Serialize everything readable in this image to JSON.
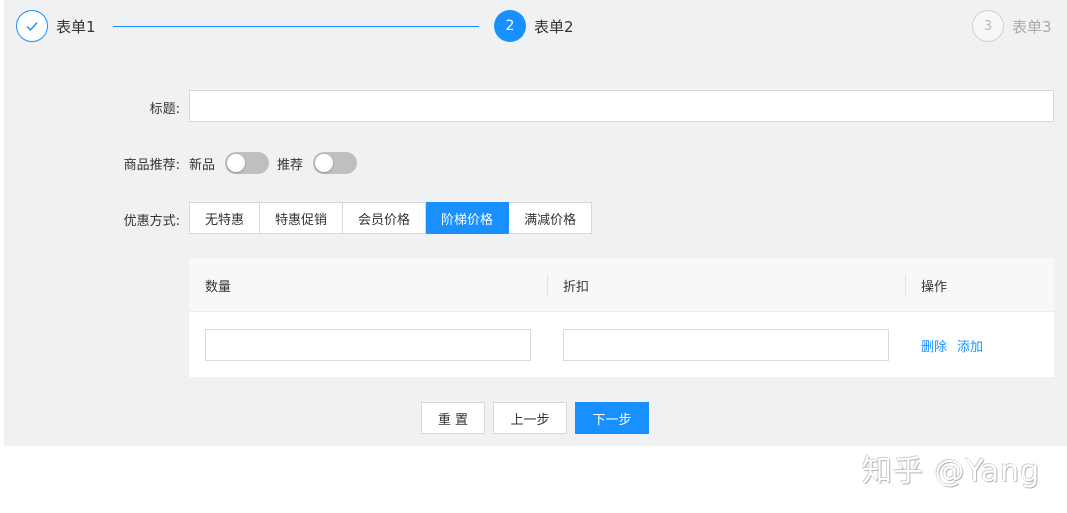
{
  "steps": [
    {
      "label": "表单1",
      "state": "done"
    },
    {
      "number": "2",
      "label": "表单2",
      "state": "active"
    },
    {
      "number": "3",
      "label": "表单3",
      "state": "pending"
    }
  ],
  "form": {
    "title_label": "标题:",
    "title_value": "",
    "recommend_label": "商品推荐:",
    "toggle_new_label": "新品",
    "toggle_new_on": false,
    "toggle_recommend_label": "推荐",
    "toggle_recommend_on": false,
    "discount_label": "优惠方式:",
    "discount_options": [
      "无特惠",
      "特惠促销",
      "会员价格",
      "阶梯价格",
      "满减价格"
    ],
    "discount_selected": "阶梯价格"
  },
  "table": {
    "columns": [
      "数量",
      "折扣",
      "操作"
    ],
    "rows": [
      {
        "quantity": "",
        "discount": "",
        "actions": [
          "删除",
          "添加"
        ]
      }
    ]
  },
  "buttons": {
    "reset": "重 置",
    "prev": "上一步",
    "next": "下一步"
  },
  "watermark": "知乎 @Yang",
  "colors": {
    "accent": "#1890ff",
    "panel_bg": "#f0f1f3",
    "switch_off": "#bfbfbf"
  }
}
